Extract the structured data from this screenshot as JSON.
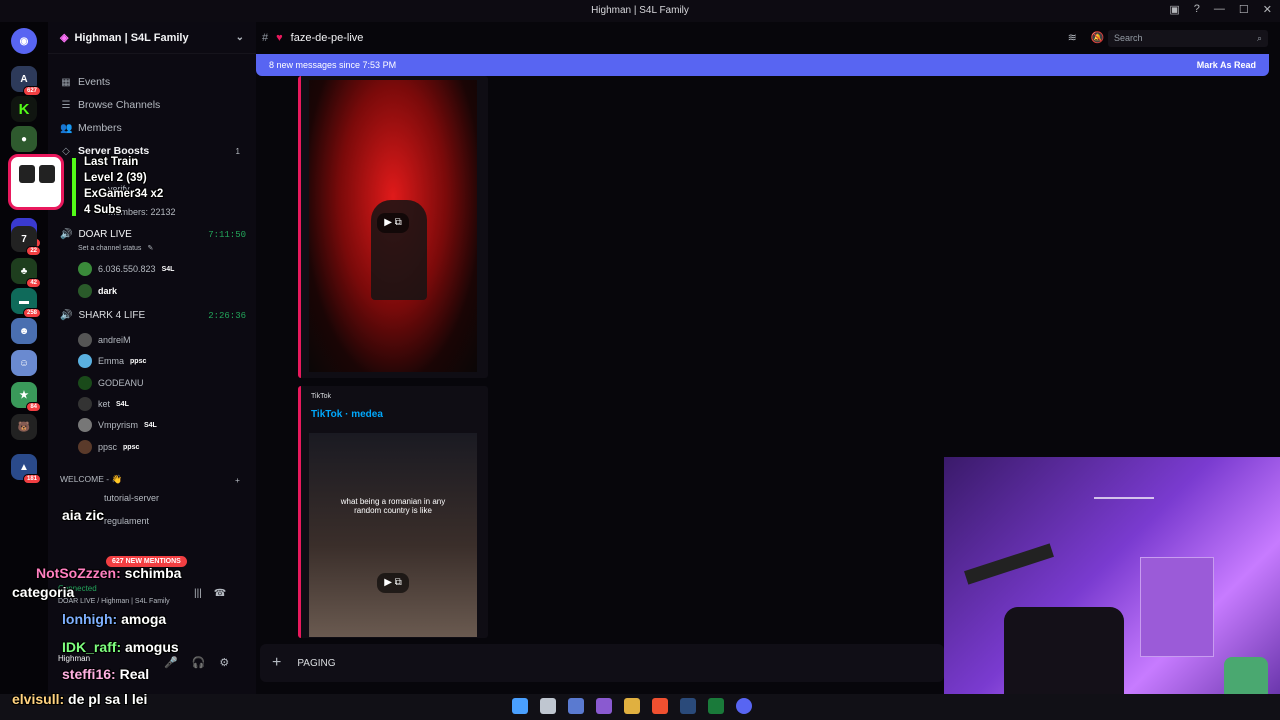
{
  "window": {
    "title": "Highman | S4L Family"
  },
  "servers": [
    {
      "name": "discord-home-icon",
      "badge": ""
    },
    {
      "name": "server-1",
      "badge": "627"
    },
    {
      "name": "server-kick",
      "badge": ""
    },
    {
      "name": "server-3",
      "badge": ""
    },
    {
      "name": "server-4",
      "badge": "318"
    },
    {
      "name": "server-5",
      "badge": "31"
    },
    {
      "name": "server-6",
      "badge": "22"
    },
    {
      "name": "server-7",
      "badge": "42"
    },
    {
      "name": "server-8",
      "badge": "258"
    },
    {
      "name": "server-9",
      "badge": ""
    },
    {
      "name": "server-10",
      "badge": ""
    },
    {
      "name": "server-11",
      "badge": "84"
    },
    {
      "name": "server-12",
      "badge": ""
    },
    {
      "name": "server-13",
      "badge": "181"
    }
  ],
  "sidebar": {
    "server_name": "Highman | S4L Family",
    "nav": [
      {
        "label": "Events"
      },
      {
        "label": "Browse Channels"
      },
      {
        "label": "Members"
      },
      {
        "label": "Server Boosts",
        "count": "1"
      }
    ],
    "verify_partial": "verify",
    "members_count": "Members: 22132",
    "voice_channels": [
      {
        "name": "DOAR LIVE",
        "timer": "7:11:50",
        "status": "Set a channel status"
      },
      {
        "name": "SHARK 4 LIFE",
        "timer": "2:26:36"
      }
    ],
    "doar_members": [
      {
        "name": "6.036.550.823",
        "tag": "S4L"
      },
      {
        "name": "dark",
        "tag": ""
      }
    ],
    "shark_members": [
      {
        "name": "andreiM",
        "tag": ""
      },
      {
        "name": "Emma",
        "tag": "ppsc"
      },
      {
        "name": "GODEANU",
        "tag": ""
      },
      {
        "name": "ket",
        "tag": "S4L"
      },
      {
        "name": "Vmpyrism",
        "tag": "S4L"
      },
      {
        "name": "ppsc",
        "tag": "ppsc"
      }
    ],
    "welcome_category": "WELCOME - 👋",
    "welcome_channels": [
      "tutorial-server",
      "regulament"
    ],
    "mentions_pill": "627 NEW MENTIONS",
    "voice_connected": "Connected",
    "voice_location": "DOAR LIVE / Highman | S4L Family",
    "user_name": "Highman"
  },
  "alert": {
    "line1": "Last Train",
    "line2": "Level 2  (39)",
    "line3": "ExGamer34 x2",
    "line4": "4 Subs"
  },
  "chat_overlay": [
    {
      "user": "",
      "msg": "aia zic",
      "color": "#c06bff"
    },
    {
      "user": "NotSoZzzen:",
      "msg": "schimba",
      "color": "#ff7fbf"
    },
    {
      "user": "",
      "msg": "categoria",
      "color": "#ffffff"
    },
    {
      "user": "lonhigh:",
      "msg": "amoga",
      "color": "#7fb0ff"
    },
    {
      "user": "IDK_raff:",
      "msg": "amogus",
      "color": "#7fff7f"
    },
    {
      "user": "steffi16:",
      "msg": "Real",
      "color": "#ffb0e0"
    },
    {
      "user": "elvisull:",
      "msg": "de pl sa l lei",
      "color": "#ffd27f"
    }
  ],
  "chat": {
    "channel": "faze-de-pe-live",
    "new_messages": "8 new messages since 7:53 PM",
    "mark_as_read": "Mark As Read",
    "search_placeholder": "Search",
    "embed2_provider": "TikTok",
    "embed2_title": "TikTok · medea",
    "embed2_caption": "what being a romanian in any random country is like",
    "composer_text": "PAGING"
  },
  "colors": {
    "accent": "#5865f2",
    "embed_border": "#e9195d",
    "online": "#23a55a"
  }
}
